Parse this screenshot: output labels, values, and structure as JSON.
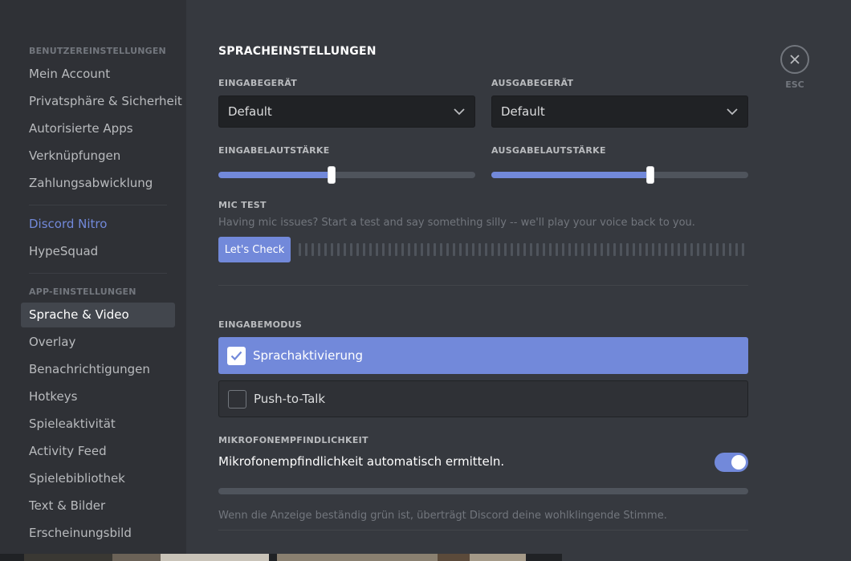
{
  "sidebar": {
    "user_settings_header": "BENUTZEREINSTELLUNGEN",
    "user_items": [
      {
        "label": "Mein Account"
      },
      {
        "label": "Privatsphäre & Sicherheit"
      },
      {
        "label": "Autorisierte Apps"
      },
      {
        "label": "Verknüpfungen"
      },
      {
        "label": "Zahlungsabwicklung"
      }
    ],
    "nitro_label": "Discord Nitro",
    "hypesquad_label": "HypeSquad",
    "app_settings_header": "APP-EINSTELLUNGEN",
    "app_items": [
      {
        "label": "Sprache & Video",
        "selected": true
      },
      {
        "label": "Overlay"
      },
      {
        "label": "Benachrichtigungen"
      },
      {
        "label": "Hotkeys"
      },
      {
        "label": "Spieleaktivität"
      },
      {
        "label": "Activity Feed"
      },
      {
        "label": "Spielebibliothek"
      },
      {
        "label": "Text & Bilder"
      },
      {
        "label": "Erscheinungsbild"
      }
    ]
  },
  "main": {
    "title": "SPRACHEINSTELLUNGEN",
    "input_device": {
      "label": "EINGABEGERÄT",
      "value": "Default"
    },
    "output_device": {
      "label": "AUSGABEGERÄT",
      "value": "Default"
    },
    "input_volume": {
      "label": "EINGABELAUTSTÄRKE",
      "percent": 44
    },
    "output_volume": {
      "label": "AUSGABELAUTSTÄRKE",
      "percent": 62
    },
    "mic_test": {
      "label": "MIC TEST",
      "hint": "Having mic issues? Start a test and say something silly -- we'll play your voice back to you.",
      "button": "Let's Check"
    },
    "input_mode": {
      "label": "EINGABEMODUS",
      "options": [
        {
          "label": "Sprachaktivierung",
          "checked": true
        },
        {
          "label": "Push-to-Talk",
          "checked": false
        }
      ]
    },
    "sensitivity": {
      "label": "MIKROFONEMPFINDLICHKEIT",
      "auto_label": "Mikrofonempfindlichkeit automatisch ermitteln.",
      "auto_enabled": true,
      "hint": "Wenn die Anzeige beständig grün ist, überträgt Discord deine wohlklingende Stimme."
    }
  },
  "close": {
    "label": "ESC"
  },
  "colors": {
    "accent": "#7289da",
    "background": "#36393f",
    "sidebar": "#2f3136",
    "input": "#202225"
  },
  "icons": [
    "chevron-down-icon",
    "check-icon",
    "close-icon"
  ]
}
